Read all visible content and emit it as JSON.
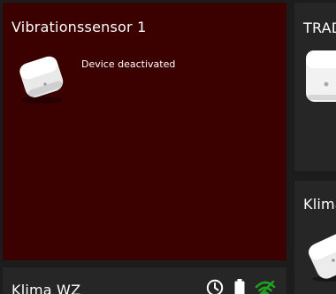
{
  "cards": {
    "vibration": {
      "title": "Vibrationssensor 1",
      "status": "Device deactivated",
      "background_color": "#3b0000",
      "icon": "vibration-sensor-device-icon"
    },
    "trad": {
      "title": "TRAD",
      "icon": "radiator-thermostat-device-icon"
    },
    "klima_right": {
      "title": "Klima",
      "icon": "climate-sensor-device-icon"
    },
    "klima_bottom": {
      "title": "Klima WZ",
      "status_icons": [
        "clock-icon",
        "battery-icon",
        "wifi-icon"
      ]
    }
  },
  "colors": {
    "page_background": "#1c1c1c",
    "card_background": "#262626",
    "wifi_signal": "#1fa31f"
  }
}
